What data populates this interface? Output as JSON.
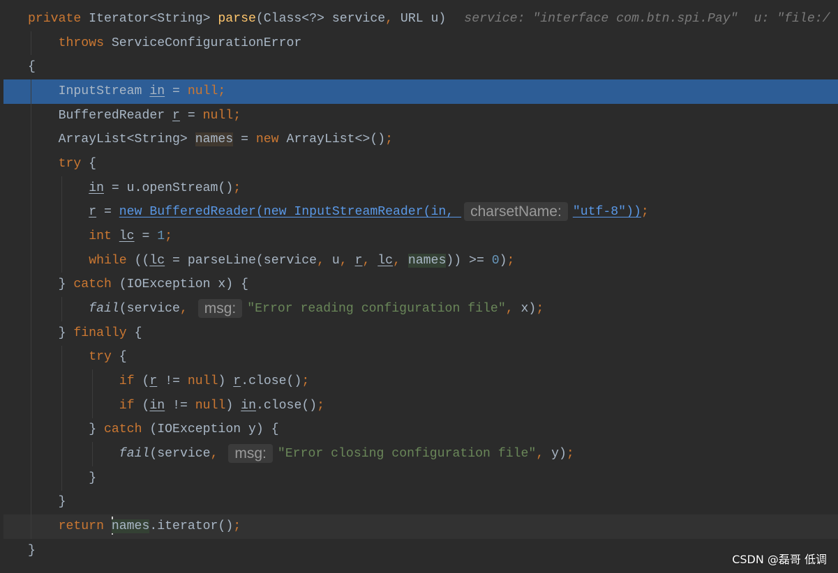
{
  "theme": {
    "background": "#2b2b2b",
    "text": "#a9b7c6",
    "keyword": "#cc7832",
    "string": "#6a8759",
    "number": "#6897bb",
    "method-decl": "#ffc66d",
    "link": "#5a98e6",
    "execution-line": "#2d5d96",
    "current-line": "#323232",
    "hint-bg": "#3b3b3b",
    "hint-text": "#9a9a9a",
    "inline-value": "#7a7a7a",
    "read-usage": "#344134",
    "write-usage": "#40382f",
    "indent-guide": "#3c3c3c",
    "caret": "#cfcfcf",
    "watermark": "#ffffff"
  },
  "inline_values": {
    "service": "service: \"interface com.btn.spi.Pay\"",
    "u": "u: \"file:/"
  },
  "param_hints": {
    "charset_name": "charsetName:",
    "msg_reading": "msg:",
    "msg_closing": "msg:"
  },
  "code": {
    "l01": [
      "private",
      " Iterator<String> ",
      "parse",
      "(Class<?> service",
      ", ",
      "URL u)"
    ],
    "l02": [
      "throws",
      " ServiceConfigurationError"
    ],
    "l03": [
      "{"
    ],
    "l04": [
      "InputStream ",
      "in",
      " = ",
      "null",
      ";"
    ],
    "l05": [
      "BufferedReader ",
      "r",
      " = ",
      "null",
      ";"
    ],
    "l06": [
      "ArrayList<String> ",
      "names",
      " = ",
      "new",
      " ArrayList<>()",
      ";"
    ],
    "l07": [
      "try",
      " {"
    ],
    "l08": [
      "in",
      " = u.openStream()",
      ";"
    ],
    "l09": [
      "r",
      " = ",
      "new BufferedReader(new InputStreamReader(in, ",
      "\"utf-8\"))",
      ";"
    ],
    "l10": [
      "int ",
      "lc",
      " = ",
      "1",
      ";"
    ],
    "l11": [
      "while",
      " ((",
      "lc",
      " = parseLine(service",
      ", ",
      "u",
      ", ",
      "r",
      ", ",
      "lc",
      ", ",
      "names",
      ")) >= ",
      "0",
      ")",
      ";"
    ],
    "l12": [
      "} ",
      "catch",
      " (IOException x) {"
    ],
    "l13": [
      "fail",
      "(service",
      ", ",
      "\"Error reading configuration file\"",
      ", ",
      "x)",
      ";"
    ],
    "l14": [
      "} ",
      "finally",
      " {"
    ],
    "l15": [
      "try",
      " {"
    ],
    "l16": [
      "if",
      " (",
      "r",
      " != ",
      "null",
      ") ",
      "r",
      ".close()",
      ";"
    ],
    "l17": [
      "if",
      " (",
      "in",
      " != ",
      "null",
      ") ",
      "in",
      ".close()",
      ";"
    ],
    "l18": [
      "} ",
      "catch",
      " (IOException y) {"
    ],
    "l19": [
      "fail",
      "(service",
      ", ",
      "\"Error closing configuration file\"",
      ", ",
      "y)",
      ";"
    ],
    "l20": [
      "}"
    ],
    "l21": [
      "}"
    ],
    "l22": [
      "return ",
      "names",
      ".iterator()",
      ";"
    ],
    "l23": [
      "}"
    ]
  },
  "watermark": "CSDN @磊哥 低调"
}
